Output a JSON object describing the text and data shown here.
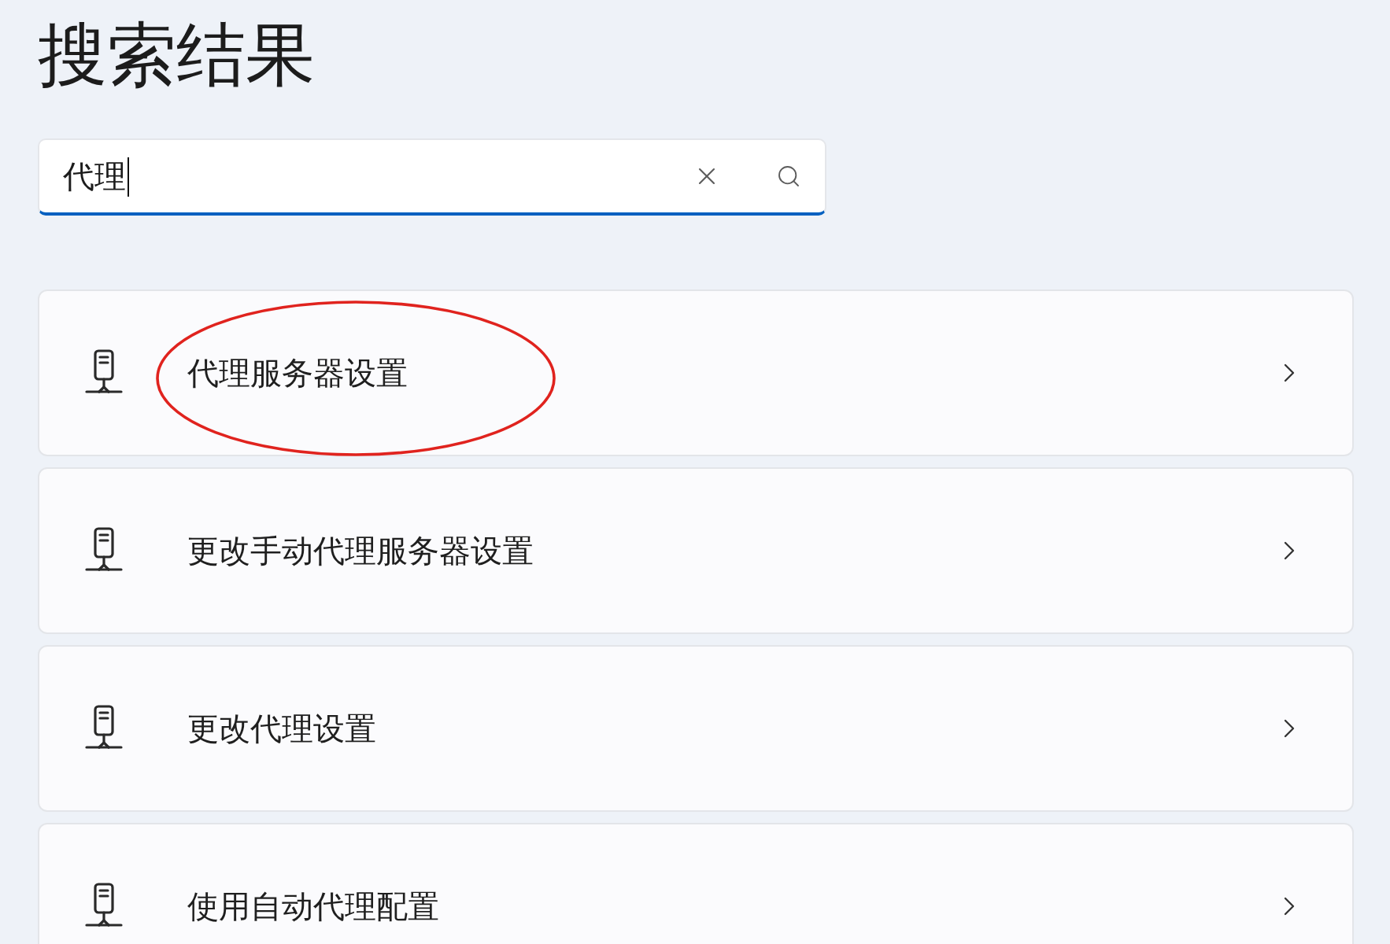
{
  "title": "搜索结果",
  "search": {
    "value": "代理",
    "focused": true
  },
  "results": [
    {
      "label": "代理服务器设置",
      "circled": true
    },
    {
      "label": "更改手动代理服务器设置",
      "circled": false
    },
    {
      "label": "更改代理设置",
      "circled": false
    },
    {
      "label": "使用自动代理配置",
      "circled": false
    }
  ]
}
